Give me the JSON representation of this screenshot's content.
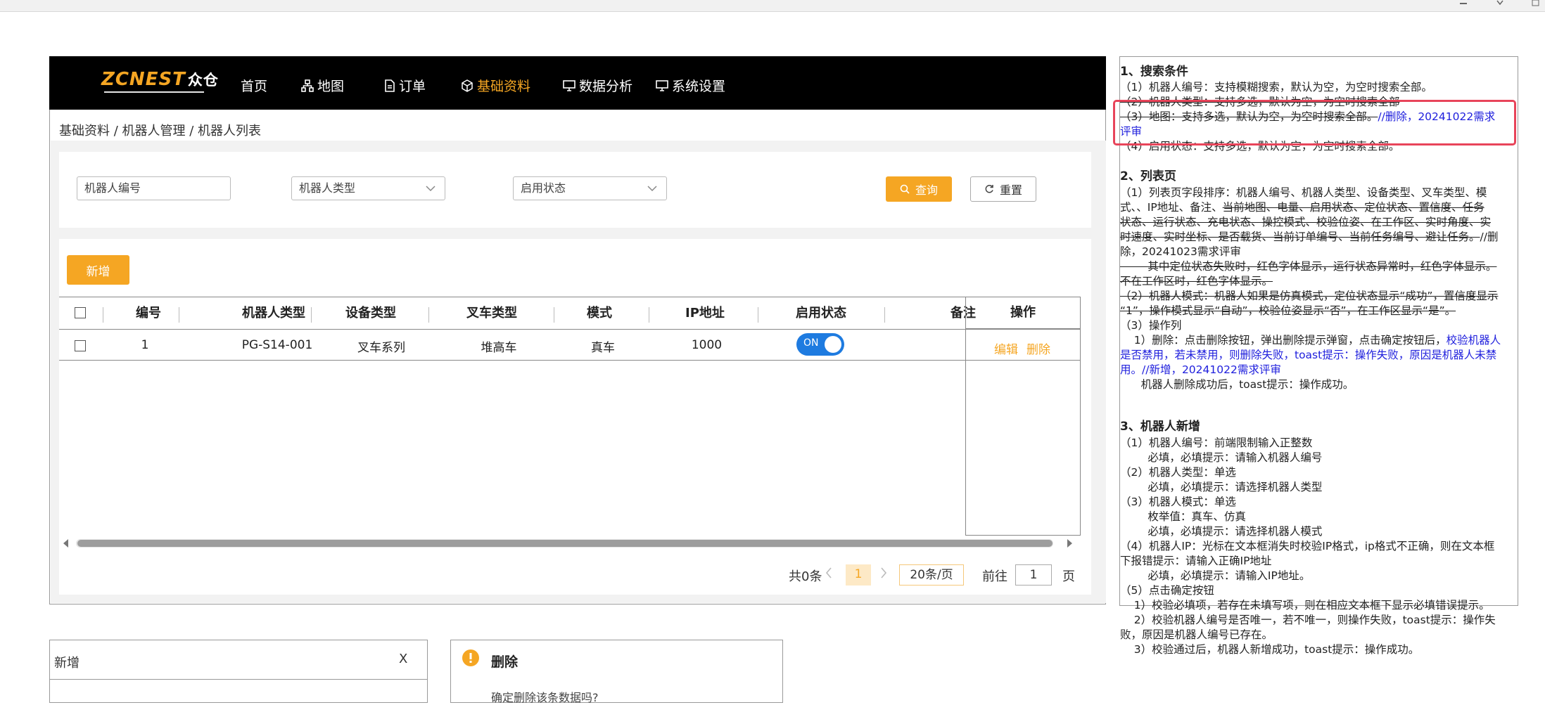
{
  "nav": {
    "logo": "ZCNEST",
    "logo_cn": "众仓",
    "items": [
      {
        "label": "首页",
        "icon": ""
      },
      {
        "label": "地图",
        "icon": "sitemap-icon"
      },
      {
        "label": "订单",
        "icon": "document-icon"
      },
      {
        "label": "基础资料",
        "icon": "cube-icon",
        "active": true
      },
      {
        "label": "数据分析",
        "icon": "monitor-icon"
      },
      {
        "label": "系统设置",
        "icon": "monitor-icon"
      }
    ],
    "accent": "#f5a623"
  },
  "breadcrumb": "基础资料 / 机器人管理 / 机器人列表",
  "search": {
    "robot_no_placeholder": "机器人编号",
    "robot_type_placeholder": "机器人类型",
    "enable_status_placeholder": "启用状态",
    "query_label": "查询",
    "reset_label": "重置"
  },
  "toolbar": {
    "add_label": "新增"
  },
  "table": {
    "headers": [
      "编号",
      "机器人类型",
      "设备类型",
      "叉车类型",
      "模式",
      "IP地址",
      "启用状态",
      "备注",
      "操作"
    ],
    "rows": [
      {
        "no": "1",
        "robot_type": "PG-S14-001",
        "device_type": "叉车系列",
        "forklift_type": "堆高车",
        "mode": "真车",
        "ip": "1000",
        "enabled": "ON",
        "remark": ""
      }
    ],
    "ops": {
      "edit": "编辑",
      "delete": "删除"
    }
  },
  "pager": {
    "total": "共0条",
    "current_page": "1",
    "page_size": "20条/页",
    "goto_prefix": "前往",
    "goto_value": "1",
    "goto_suffix": "页"
  },
  "notes": {
    "s1_title": "1、搜索条件",
    "s1_l1": "（1）机器人编号：支持模糊搜索，默认为空，为空时搜索全部。",
    "s1_l2": "（2）机器人类型：支持多选，默认为空，为空时搜索全部",
    "s1_l3_strike": "（3）地图：支持多选，默认为空，为空时搜索全部。",
    "s1_l3_blue": "//删除，20241022需求",
    "s1_l3b_blue": "评审",
    "s1_l4": "（4）启用状态：支持多选，默认为空，为空时搜索全部。",
    "s2_title": "2、列表页",
    "s2_l1": "（1）列表页字段排序：机器人编号、机器人类型、设备类型、叉车类型、模",
    "s2_l2a": "式、、IP地址、备注、",
    "s2_l2b": "当前地图、电量、启用状态、定位状态、置信度、任务",
    "s2_l3": "状态、运行状态、充电状态、操控模式、校验位姿、在工作区、实时角度、实",
    "s2_l4a": "时速度、实时坐标、是否载货、当前订单编号、当前任务编号、避让任务。",
    "s2_l4b": "//删",
    "s2_l5": "除，20241023需求评审",
    "s2_l6": "        其中定位状态失败时，红色字体显示，运行状态异常时，红色字体显示。",
    "s2_l7": "不在工作区时，红色字体显示。",
    "s2_l8": "（2）机器人模式：机器人如果是仿真模式，定位状态显示“成功”，置信度显示",
    "s2_l9": "“1”，操作模式显示“自动”，校验位姿显示“否”，在工作区显示“是”。",
    "s2_l10": "（3）操作列",
    "s2_l11a": "    1）删除：点击删除按钮，弹出删除提示弹窗，点击确定按钮后，",
    "s2_l11b": "校验机器人",
    "s2_l12": "是否禁用，若未禁用，则删除失败，toast提示：操作失败，原因是机器人未禁",
    "s2_l13": "用。//新增，20241022需求评审",
    "s2_l14": "      机器人删除成功后，toast提示：操作成功。",
    "s3_title": "3、机器人新增",
    "s3_l1": "（1）机器人编号：前端限制输入正整数",
    "s3_l2": "        必填，必填提示：请输入机器人编号",
    "s3_l3": "（2）机器人类型：单选",
    "s3_l4": "        必填，必填提示：请选择机器人类型",
    "s3_l5": "（3）机器人模式：单选",
    "s3_l6": "        枚举值：真车、仿真",
    "s3_l7": "        必填，必填提示：请选择机器人模式",
    "s3_l8": "（4）机器人IP：光标在文本框消失时校验IP格式，ip格式不正确，则在文本框",
    "s3_l9": "下报错提示：请输入正确IP地址",
    "s3_l10": "        必填，必填提示：请输入IP地址。",
    "s3_l11": "（5）点击确定按钮",
    "s3_l12": "    1）校验必填项，若存在未填写项，则在相应文本框下显示必填错误提示。",
    "s3_l13": "    2）校验机器人编号是否唯一，若不唯一，则操作失败，toast提示：操作失",
    "s3_l14": "败，原因是机器人编号已存在。",
    "s3_l15": "    3）校验通过后，机器人新增成功，toast提示：操作成功。"
  },
  "dialogs": {
    "add_title": "新增",
    "close_label": "X",
    "delete_title": "删除",
    "delete_msg": "确定删除该条数据吗?"
  }
}
